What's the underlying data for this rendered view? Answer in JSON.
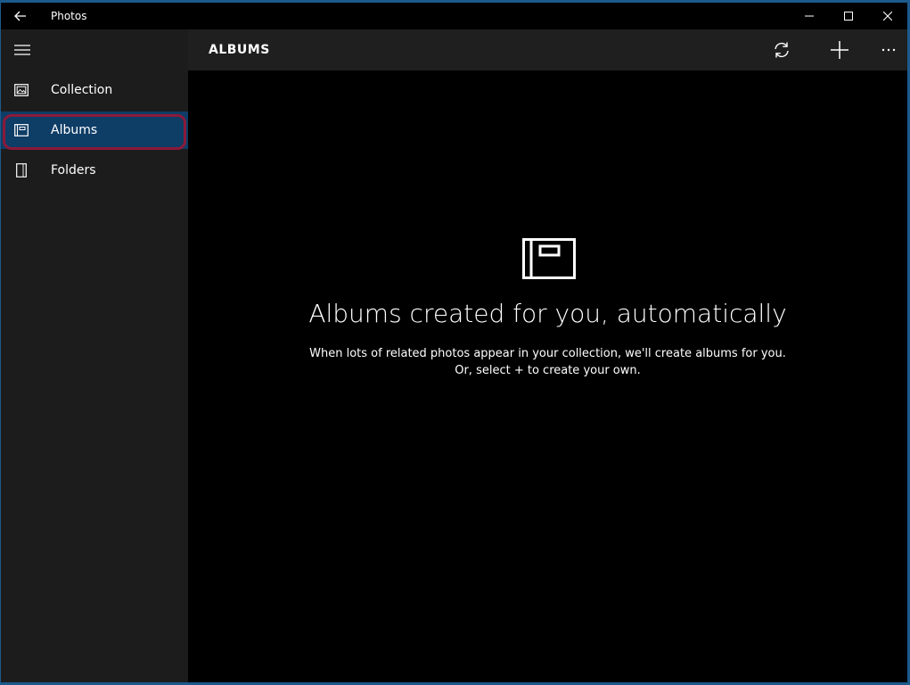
{
  "app": {
    "title": "Photos"
  },
  "window_controls": {
    "back_icon": "back-arrow-icon",
    "minimize_icon": "minimize-icon",
    "maximize_icon": "maximize-icon",
    "close_icon": "close-icon"
  },
  "sidebar": {
    "menu_icon": "hamburger-icon",
    "items": [
      {
        "label": "Collection",
        "icon": "collection-icon",
        "selected": false
      },
      {
        "label": "Albums",
        "icon": "album-icon",
        "selected": true
      },
      {
        "label": "Folders",
        "icon": "folder-icon",
        "selected": false
      }
    ]
  },
  "header": {
    "title": "ALBUMS",
    "actions": [
      {
        "icon": "refresh-icon"
      },
      {
        "icon": "add-icon"
      },
      {
        "icon": "more-icon"
      }
    ]
  },
  "empty_state": {
    "icon": "album-icon",
    "title": "Albums created for you, automatically",
    "line1": "When lots of related photos appear in your collection, we'll create albums for you.",
    "line2": "Or, select + to create your own."
  },
  "colors": {
    "window_background": "#000000",
    "sidebar_background": "#1c1c1c",
    "header_background": "#1f1f1f",
    "selected_item": "#0e3d66",
    "highlight_ring": "#8b1a3a",
    "desktop_border": "#1c5a8c"
  }
}
